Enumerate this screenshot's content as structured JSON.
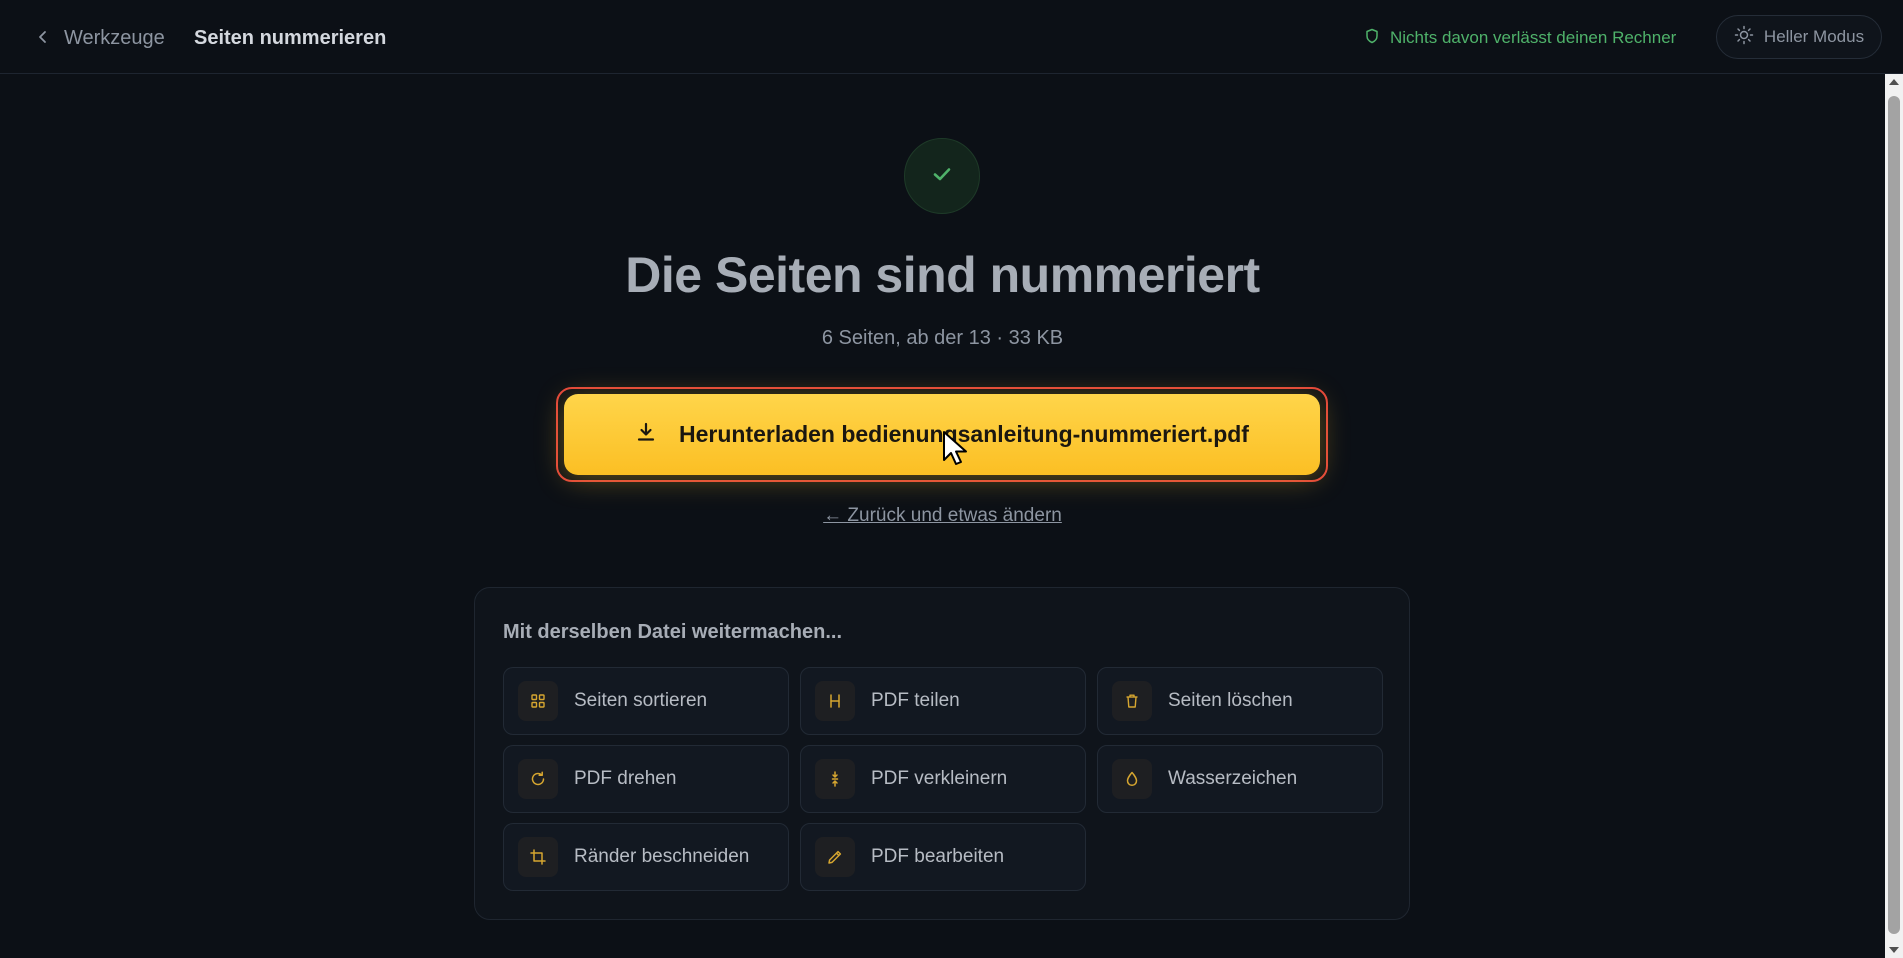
{
  "header": {
    "back_label": "Werkzeuge",
    "title": "Seiten nummerieren",
    "privacy_note": "Nichts davon verlässt deinen Rechner",
    "theme_toggle_label": "Heller Modus"
  },
  "result": {
    "headline": "Die Seiten sind nummeriert",
    "summary": "6 Seiten, ab der 13 · 33 KB",
    "download_label": "Herunterladen bedienungsanleitung-nummeriert.pdf",
    "back_label": "← Zurück und etwas ändern"
  },
  "continue": {
    "title": "Mit derselben Datei weitermachen...",
    "tools": [
      {
        "label": "Seiten sortieren",
        "icon": "grid-icon"
      },
      {
        "label": "PDF teilen",
        "icon": "split-icon"
      },
      {
        "label": "Seiten löschen",
        "icon": "trash-icon"
      },
      {
        "label": "PDF drehen",
        "icon": "rotate-icon"
      },
      {
        "label": "PDF verkleinern",
        "icon": "compress-icon"
      },
      {
        "label": "Wasserzeichen",
        "icon": "droplet-icon"
      },
      {
        "label": "Ränder beschneiden",
        "icon": "crop-icon"
      },
      {
        "label": "PDF bearbeiten",
        "icon": "pencil-icon"
      }
    ]
  },
  "colors": {
    "background": "#0c1016",
    "accent": "#fbbf24",
    "success": "#4fb26a",
    "focus_ring": "#e2453c"
  }
}
